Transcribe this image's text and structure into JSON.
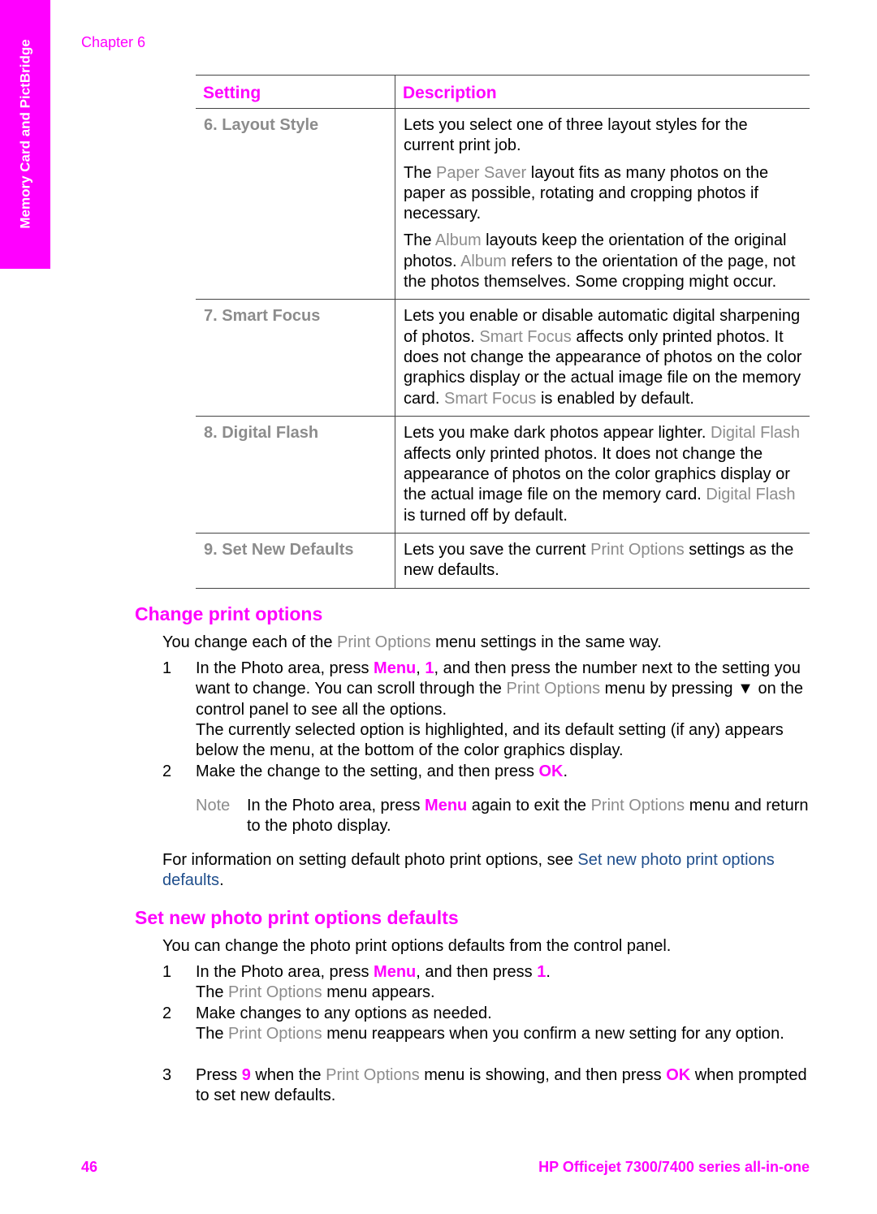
{
  "header": {
    "chapter": "Chapter 6"
  },
  "side_tab": "Memory Card and PictBridge",
  "table": {
    "headers": [
      "Setting",
      "Description"
    ],
    "rows": [
      {
        "setting": "6. Layout Style",
        "desc": [
          [
            {
              "t": "Lets you select one of three layout styles for the current print job."
            }
          ],
          [
            {
              "t": "The "
            },
            {
              "t": "Paper Saver",
              "s": "grayb"
            },
            {
              "t": " layout fits as many photos on the paper as possible, rotating and cropping photos if necessary."
            }
          ],
          [
            {
              "t": "The "
            },
            {
              "t": "Album",
              "s": "grayb"
            },
            {
              "t": " layouts keep the orientation of the original photos. "
            },
            {
              "t": "Album",
              "s": "grayb"
            },
            {
              "t": " refers to the orientation of the page, not the photos themselves. Some cropping might occur."
            }
          ]
        ]
      },
      {
        "setting": "7. Smart Focus",
        "desc": [
          [
            {
              "t": "Lets you enable or disable automatic digital sharpening of photos. "
            },
            {
              "t": "Smart Focus",
              "s": "grayb"
            },
            {
              "t": " affects only printed photos. It does not change the appearance of photos on the color graphics display or the actual image file on the memory card. "
            },
            {
              "t": "Smart Focus",
              "s": "grayb"
            },
            {
              "t": " is enabled by default."
            }
          ]
        ]
      },
      {
        "setting": "8. Digital Flash",
        "desc": [
          [
            {
              "t": "Lets you make dark photos appear lighter. "
            },
            {
              "t": "Digital Flash",
              "s": "grayb"
            },
            {
              "t": " affects only printed photos. It does not change the appearance of photos on the color graphics display or the actual image file on the memory card. "
            },
            {
              "t": "Digital Flash",
              "s": "grayb"
            },
            {
              "t": " is turned off by default."
            }
          ]
        ]
      },
      {
        "setting": "9. Set New Defaults",
        "desc": [
          [
            {
              "t": "Lets you save the current "
            },
            {
              "t": "Print Options",
              "s": "grayb"
            },
            {
              "t": " settings as the new defaults."
            }
          ]
        ]
      }
    ]
  },
  "section1": {
    "heading": "Change print options",
    "intro": [
      {
        "t": "You change each of the "
      },
      {
        "t": "Print Options",
        "s": "grayb"
      },
      {
        "t": " menu settings in the same way."
      }
    ],
    "steps": [
      {
        "num": "1",
        "body": [
          {
            "t": "In the Photo area, press "
          },
          {
            "t": "Menu",
            "s": "pink"
          },
          {
            "t": ", "
          },
          {
            "t": "1",
            "s": "pink"
          },
          {
            "t": ", and then press the number next to the setting you want to change. You can scroll through the "
          },
          {
            "t": "Print Options",
            "s": "grayb"
          },
          {
            "t": " menu by pressing "
          },
          {
            "t": "▼",
            "s": "arrow"
          },
          {
            "t": " on the control panel to see all the options."
          }
        ],
        "extra": [
          {
            "t": "The currently selected option is highlighted, and its default setting (if any) appears below the menu, at the bottom of the color graphics display."
          }
        ]
      },
      {
        "num": "2",
        "body": [
          {
            "t": "Make the change to the setting, and then press "
          },
          {
            "t": "OK",
            "s": "pink"
          },
          {
            "t": "."
          }
        ]
      }
    ],
    "note": {
      "label": "Note",
      "body": [
        {
          "t": "In the Photo area, press "
        },
        {
          "t": "Menu",
          "s": "pink"
        },
        {
          "t": " again to exit the "
        },
        {
          "t": "Print Options",
          "s": "grayb"
        },
        {
          "t": " menu and return to the photo display."
        }
      ]
    },
    "more": [
      {
        "t": "For information on setting default photo print options, see "
      },
      {
        "t": "Set new photo print options defaults",
        "s": "link"
      },
      {
        "t": "."
      }
    ]
  },
  "section2": {
    "heading": "Set new photo print options defaults",
    "intro": [
      {
        "t": "You can change the photo print options defaults from the control panel."
      }
    ],
    "steps": [
      {
        "num": "1",
        "body": [
          {
            "t": "In the Photo area, press "
          },
          {
            "t": "Menu",
            "s": "pink"
          },
          {
            "t": ", and then press "
          },
          {
            "t": "1",
            "s": "pink"
          },
          {
            "t": "."
          }
        ],
        "extra": [
          {
            "t": "The "
          },
          {
            "t": "Print Options",
            "s": "grayb"
          },
          {
            "t": " menu appears."
          }
        ]
      },
      {
        "num": "2",
        "body": [
          {
            "t": "Make changes to any options as needed."
          }
        ],
        "extra": [
          {
            "t": "The "
          },
          {
            "t": "Print Options",
            "s": "grayb"
          },
          {
            "t": " menu reappears when you confirm a new setting for any option."
          }
        ]
      },
      {
        "num": "3",
        "body": [
          {
            "t": "Press "
          },
          {
            "t": "9",
            "s": "pink"
          },
          {
            "t": " when the "
          },
          {
            "t": "Print Options",
            "s": "grayb"
          },
          {
            "t": " menu is showing, and then press "
          },
          {
            "t": "OK",
            "s": "pink"
          },
          {
            "t": " when prompted to set new defaults."
          }
        ]
      }
    ]
  },
  "footer": {
    "page_number": "46",
    "product": "HP Officejet 7300/7400 series all-in-one"
  },
  "colors": {
    "accent": "#ff00ff",
    "ui_term": "#8c8c8c",
    "link": "#1f4e8c",
    "side_tab": "#ff00ff"
  }
}
